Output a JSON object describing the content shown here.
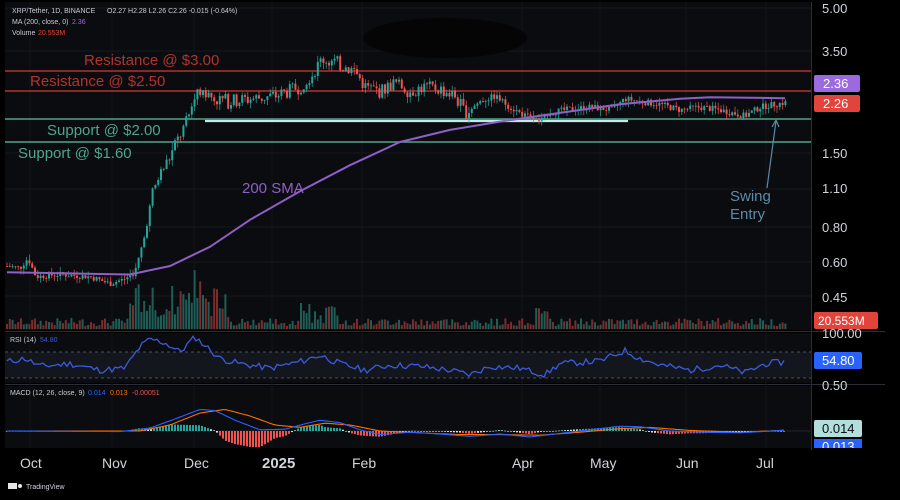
{
  "header": {
    "symbol_line": "XRP/Tether, 1D, BINANCE",
    "ohlc": "O2.27 H2.28 L2.26 C2.26 -0.015 (-0.64%)",
    "ma_line": "MA (200, close, 0)",
    "ma_value": "2.36",
    "volume_label": "Volume",
    "volume_value": "20.553M"
  },
  "annotations": {
    "resistance_3": "Resistance @ $3.00",
    "resistance_25": "Resistance @ $2.50",
    "support_2": "Support @ $2.00",
    "support_16": "Support @ $1.60",
    "sma_label": "200 SMA",
    "swing_1": "Swing",
    "swing_2": "Entry"
  },
  "price_axis": {
    "ticks": [
      "5.00",
      "3.50",
      "1.50",
      "1.10",
      "0.80",
      "0.60",
      "0.45"
    ],
    "badge_ma": "2.36",
    "badge_price": "2.26",
    "badge_volume": "20.553M"
  },
  "rsi": {
    "label": "RSI (14)",
    "value": "54.80",
    "top_tick": "100.00",
    "value_badge": "54.80"
  },
  "macd": {
    "label": "MACD (12, 26, close, 9)",
    "v1": "0.014",
    "v2": "0.013",
    "v3": "-0.00051",
    "top_tick": "0.50",
    "badge1": "0.014",
    "badge2": "0.013"
  },
  "time_axis": [
    "Oct",
    "Nov",
    "Dec",
    "2025",
    "Feb",
    "Apr",
    "May",
    "Jun",
    "Jul"
  ],
  "footer": {
    "brand": "TradingView"
  },
  "colors": {
    "bg": "#000000",
    "panel": "#0b0c10",
    "up": "#26a69a",
    "down": "#ef5350",
    "resistance": "#b2332d",
    "support": "#4fa58b",
    "sma": "#8e5fc6",
    "rsi": "#3b5bdb",
    "macd": "#2962ff",
    "signal": "#ff6d00",
    "badge_purple": "#9c6ade",
    "badge_red": "#e0443a",
    "badge_blue": "#2962ff",
    "badge_teal": "#b2dfdb"
  },
  "chart_data": [
    {
      "type": "line",
      "title": "XRP/Tether, 1D, BINANCE",
      "x": [
        "Oct",
        "Nov",
        "Dec",
        "2025",
        "Feb",
        "Apr",
        "May",
        "Jun",
        "Jul"
      ],
      "series": [
        {
          "name": "",
          "values": [
            0.56,
            0.51,
            2.4,
            2.35,
            2.9,
            2.05,
            2.3,
            2.15,
            2.26
          ]
        },
        {
          "name": "MA (200, close, 0)",
          "values": [
            0.55,
            0.55,
            0.6,
            1.1,
            1.7,
            2.1,
            2.25,
            2.36,
            2.36
          ]
        }
      ],
      "horizontal_lines": [
        3.0,
        2.5,
        2.0,
        1.6
      ],
      "scale": "log",
      "ylim": [
        0.4,
        5.0
      ]
    },
    {
      "type": "line",
      "title": "RSI (14)",
      "x": [
        "Oct",
        "Nov",
        "Dec",
        "2025",
        "Feb",
        "Apr",
        "May",
        "Jun",
        "Jul"
      ],
      "values": [
        45,
        40,
        88,
        60,
        55,
        42,
        58,
        48,
        54.8
      ]
    },
    {
      "type": "line",
      "title": "MACD (12, 26, close, 9)",
      "x": [
        "Oct",
        "Nov",
        "Dec",
        "2025",
        "Feb",
        "Apr",
        "May",
        "Jun",
        "Jul"
      ],
      "series": [
        {
          "name": "",
          "values": [
            0.0,
            -0.01,
            0.32,
            0.05,
            0.12,
            -0.08,
            0.05,
            -0.01,
            0.014
          ]
        },
        {
          "name": "",
          "values": [
            0.0,
            0.0,
            0.25,
            0.12,
            0.1,
            -0.05,
            0.04,
            0.0,
            0.013
          ]
        }
      ]
    }
  ]
}
